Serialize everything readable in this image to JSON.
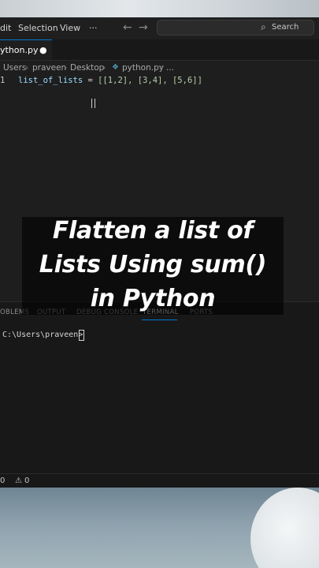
{
  "menu": {
    "edit": "dit",
    "selection": "Selection",
    "view": "View",
    "more": "···"
  },
  "nav": {
    "back": "←",
    "forward": "→"
  },
  "search": {
    "icon": "search-icon",
    "label": "Search"
  },
  "tab": {
    "label": "ython.py",
    "dirty_dot": "●"
  },
  "breadcrumb": {
    "items": [
      "Users",
      "praveen",
      "Desktop",
      "python.py",
      "..."
    ],
    "separator": "›"
  },
  "editor": {
    "line_number": "1",
    "code": {
      "var": "list_of_lists",
      "op": " = ",
      "value": "[[1,2], [3,4], [5,6]]"
    }
  },
  "panel": {
    "tabs": [
      "OBLEMS",
      "OUTPUT",
      "DEBUG CONSOLE",
      "TERMINAL",
      "PORTS"
    ],
    "active_tab": "TERMINAL",
    "prompt": "C:\\Users\\praveen>"
  },
  "status": {
    "errors": "0",
    "warnings": "0"
  },
  "caption": {
    "line1": "Flatten a list of",
    "line2": "Lists Using sum()",
    "line3": "in Python"
  },
  "colors": {
    "accent": "#0078d4",
    "editor_bg": "#1e1e1e",
    "variable": "#9cdcfe",
    "number": "#b5cea8"
  }
}
